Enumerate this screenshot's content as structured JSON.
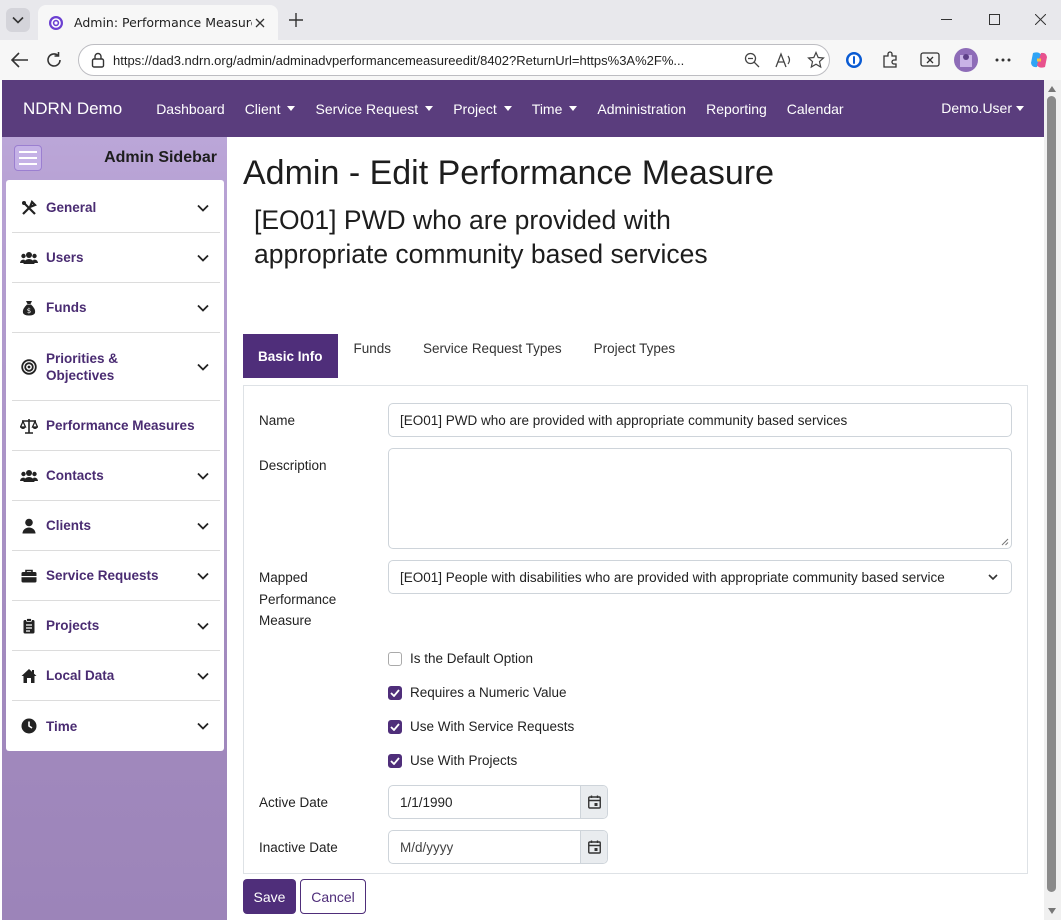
{
  "browser": {
    "tab_title": "Admin: Performance Measure",
    "url": "https://dad3.ndrn.org/admin/adminadvperformancemeasureedit/8402?ReturnUrl=https%3A%2F%...",
    "address_icons": [
      "zoom-out-icon",
      "read-aloud-icon",
      "favorite-star-icon"
    ],
    "toolbar_icons": [
      "password-manager-icon",
      "extensions-icon",
      "screenshot-icon",
      "profile-avatar",
      "more-icon",
      "copilot-icon"
    ]
  },
  "navbar": {
    "brand": "NDRN Demo",
    "items": [
      {
        "label": "Dashboard",
        "dropdown": false
      },
      {
        "label": "Client",
        "dropdown": true
      },
      {
        "label": "Service Request",
        "dropdown": true
      },
      {
        "label": "Project",
        "dropdown": true
      },
      {
        "label": "Time",
        "dropdown": true
      },
      {
        "label": "Administration",
        "dropdown": false
      },
      {
        "label": "Reporting",
        "dropdown": false
      },
      {
        "label": "Calendar",
        "dropdown": false
      }
    ],
    "user": "Demo.User"
  },
  "sidebar": {
    "title": "Admin Sidebar",
    "items": [
      {
        "label": "General",
        "icon": "tools-icon"
      },
      {
        "label": "Users",
        "icon": "users-icon"
      },
      {
        "label": "Funds",
        "icon": "money-bag-icon"
      },
      {
        "label": "Priorities & Objectives",
        "icon": "target-icon"
      },
      {
        "label": "Performance Measures",
        "icon": "scales-icon"
      },
      {
        "label": "Contacts",
        "icon": "users-icon"
      },
      {
        "label": "Clients",
        "icon": "user-icon"
      },
      {
        "label": "Service Requests",
        "icon": "briefcase-icon"
      },
      {
        "label": "Projects",
        "icon": "clipboard-icon"
      },
      {
        "label": "Local Data",
        "icon": "house-icon"
      },
      {
        "label": "Time",
        "icon": "clock-icon"
      }
    ]
  },
  "page": {
    "title": "Admin - Edit Performance Measure",
    "subtitle": "[EO01] PWD who are provided with appropriate community based services"
  },
  "tabs": [
    {
      "label": "Basic Info",
      "active": true
    },
    {
      "label": "Funds",
      "active": false
    },
    {
      "label": "Service Request Types",
      "active": false
    },
    {
      "label": "Project Types",
      "active": false
    }
  ],
  "form": {
    "name_label": "Name",
    "name_value": "[EO01] PWD who are provided with appropriate community based services",
    "description_label": "Description",
    "description_value": "",
    "mapped_label": "Mapped Performance Measure",
    "mapped_value": "[EO01] People with disabilities who are provided with appropriate community based service",
    "checkboxes": [
      {
        "label": "Is the Default Option",
        "checked": false
      },
      {
        "label": "Requires a Numeric Value",
        "checked": true
      },
      {
        "label": "Use With Service Requests",
        "checked": true
      },
      {
        "label": "Use With Projects",
        "checked": true
      }
    ],
    "active_date_label": "Active Date",
    "active_date_value": "1/1/1990",
    "inactive_date_label": "Inactive Date",
    "inactive_date_placeholder": "M/d/yyyy"
  },
  "buttons": {
    "save": "Save",
    "cancel": "Cancel"
  },
  "colors": {
    "brand_purple": "#5a3d7d",
    "accent_purple": "#4f2e7a",
    "sidebar_lavender": "#b6a0d2"
  }
}
